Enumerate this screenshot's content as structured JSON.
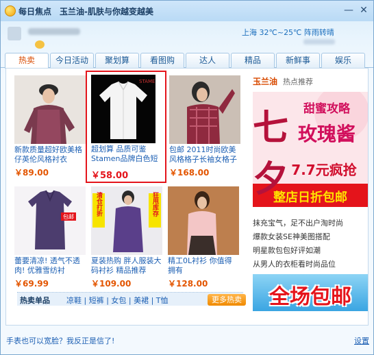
{
  "window": {
    "app_name": "每日焦点",
    "title": "玉兰油-肌肤与你越变越美",
    "minimize_label": "—",
    "close_label": "✕"
  },
  "user": {
    "weather": "上海 32℃~25℃ 阵雨转晴"
  },
  "tabs": [
    {
      "label": "热卖"
    },
    {
      "label": "今日活动"
    },
    {
      "label": "聚划算"
    },
    {
      "label": "看图购"
    },
    {
      "label": "达人"
    },
    {
      "label": "精品"
    },
    {
      "label": "新鲜事"
    },
    {
      "label": "娱乐"
    }
  ],
  "products": [
    {
      "desc": "新款质量超好欧美格仔英伦风格衬衣",
      "price": "￥89.00"
    },
    {
      "desc": "超划算 品质可鉴 Stamen品牌白色短",
      "price": "￥58.00",
      "brand_mark": "STAMEN"
    },
    {
      "desc": "包邮 2011时尚欧美风格格子长袖女格子",
      "price": "￥168.00"
    },
    {
      "desc": "蕾要清凉! 透气不透肉! 优雅雪纺衬",
      "price": "￥69.99",
      "sticker": "包邮"
    },
    {
      "desc": "夏装热购 胖人服装大码衬衫 精品推荐",
      "price": "￥109.00",
      "sticker": "清仓打折",
      "sticker2": "狂甩库存"
    },
    {
      "desc": "精工0L衬衫 你值得拥有",
      "price": "￥128.00"
    }
  ],
  "hot": {
    "title": "热卖单品",
    "links": "凉鞋 | 短裤 | 女包 | 美裙 | T恤",
    "more": "更多热卖"
  },
  "right": {
    "brand": "玉兰油",
    "tag": "热点推荐",
    "promo": {
      "line1": "甜蜜攻略",
      "big": "七夕",
      "line2": "玫瑰酱",
      "line3": "7.7元疯抢",
      "footer": "整店日折包邮"
    },
    "headlines": [
      "抹充宝气，足不出户淘时尚",
      "爆款女装SE神美图搭配",
      "明星款包包好评如潮",
      "从男人的衣柜看时尚品位"
    ],
    "banner": "全场包邮"
  },
  "footer": {
    "left": "手表也可以宽脸？我反正是信了!",
    "settings": "设置"
  },
  "colors": {
    "accent": "#e4141b",
    "link": "#1c5fb3",
    "price": "#e35500"
  }
}
